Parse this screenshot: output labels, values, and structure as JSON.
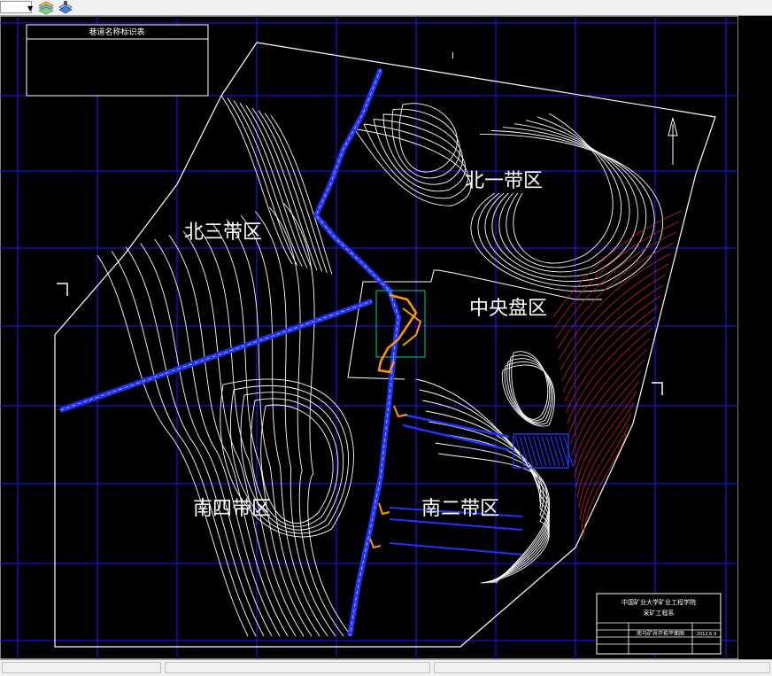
{
  "toolbar": {
    "dropdown_arrow": "▼",
    "layers_icon": "layers-icon",
    "layer_state_icon": "layer-state-icon"
  },
  "drawing": {
    "zones": {
      "north_one": "北一带区",
      "north_three": "北三带区",
      "central": "中央盘区",
      "south_four": "南四带区",
      "south_two": "南二带区"
    },
    "section_marker": "I",
    "legend_table": {
      "title": "巷道名称标识表"
    },
    "title_block": {
      "org_line1": "中国矿业大学矿业工程学院",
      "org_line2": "采矿工程系",
      "drawing_title": "南马矿井开拓平面图",
      "date": "2012.6.9"
    }
  },
  "colors": {
    "background": "#000000",
    "grid": "#1a1aff",
    "contour": "#ffffff",
    "roadway": "#2233ff",
    "shaft_area": "#ff9900",
    "fault_hatch": "#cc2222",
    "chrome": "#f0f0f0"
  }
}
